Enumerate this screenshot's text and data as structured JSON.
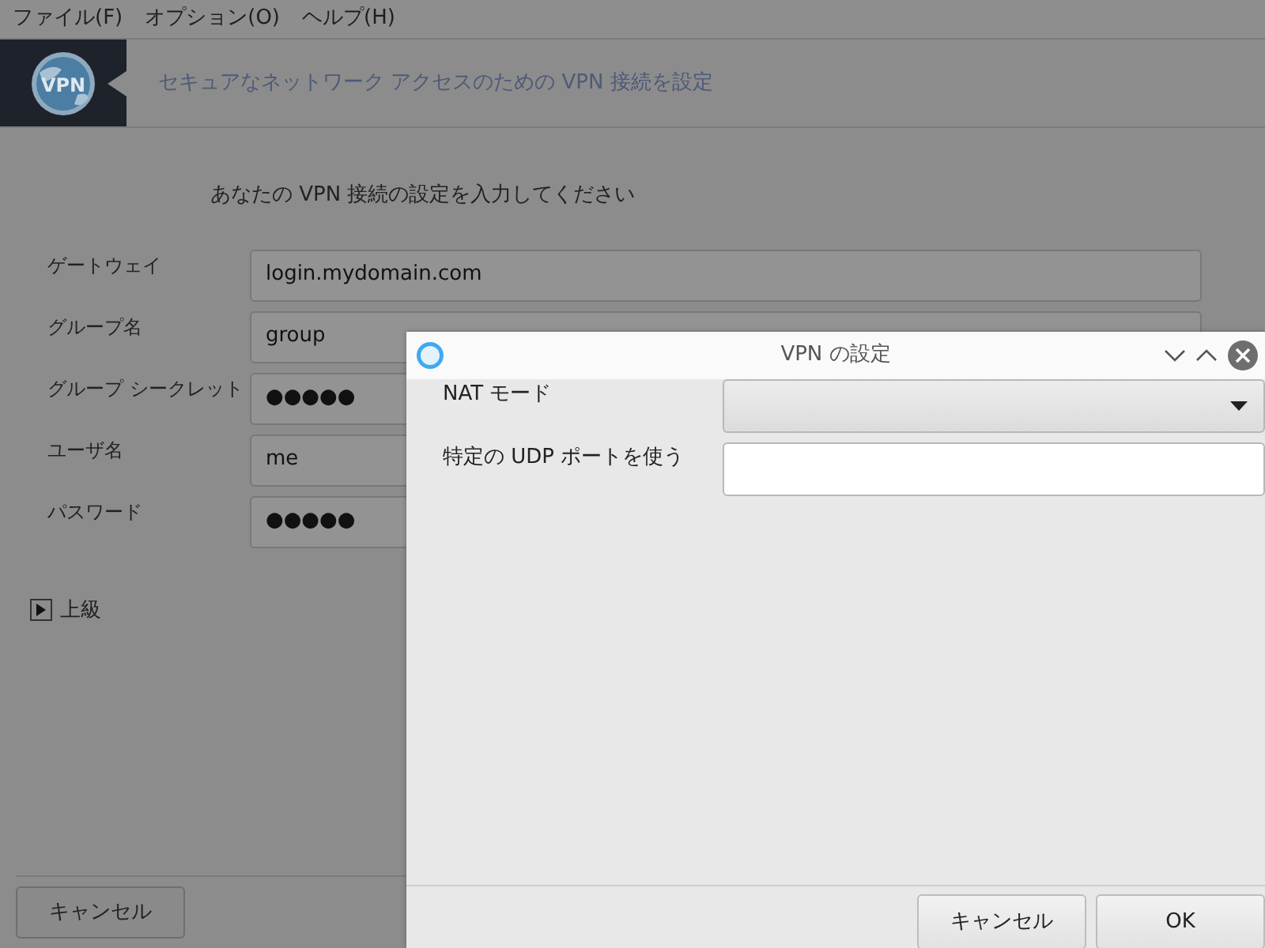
{
  "menu": [
    "ファイル(F)",
    "オプション(O)",
    "ヘルプ(H)"
  ],
  "header": {
    "logo_text": "VPN",
    "title": "セキュアなネットワーク アクセスのための VPN 接続を設定"
  },
  "prompt": "あなたの VPN 接続の設定を入力してください",
  "fields": [
    {
      "label": "ゲートウェイ",
      "value": "login.mydomain.com"
    },
    {
      "label": "グループ名",
      "value": "group"
    },
    {
      "label": "グループ シークレット",
      "value": "●●●●●"
    },
    {
      "label": "ユーザ名",
      "value": "me"
    },
    {
      "label": "パスワード",
      "value": "●●●●●"
    }
  ],
  "advanced": {
    "label": "上級",
    "expanded": false
  },
  "cancel_button": "キャンセル",
  "dialog": {
    "title": "VPN の設定",
    "rows": [
      {
        "kind": "combo",
        "label": "NAT モード"
      },
      {
        "kind": "entry",
        "label": "特定の UDP ポートを使う"
      }
    ],
    "buttons": [
      "キャンセル",
      "OK"
    ]
  }
}
